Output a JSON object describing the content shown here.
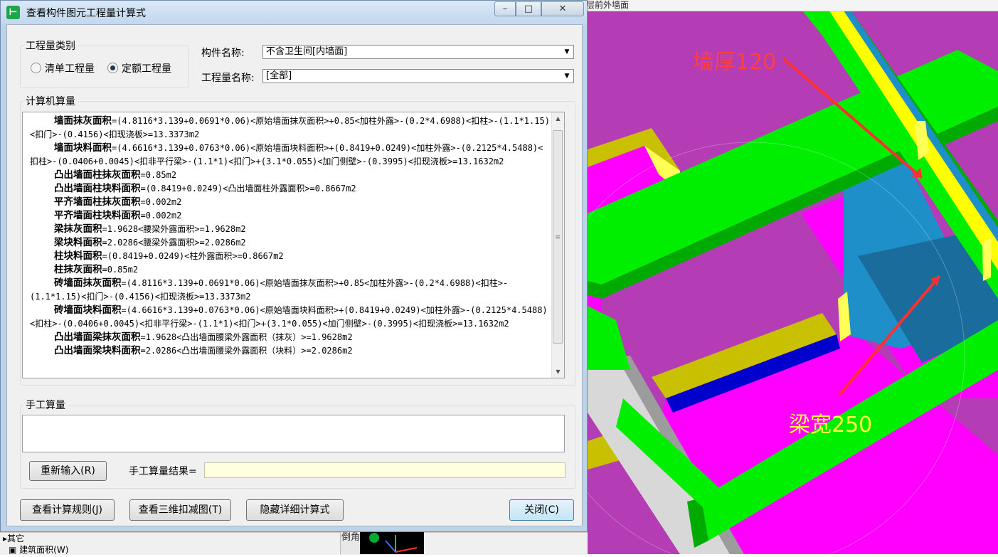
{
  "dialog": {
    "title": "查看构件图元工程量计算式",
    "app_icon": "H-logo-icon",
    "window_buttons": {
      "minimize": "–",
      "maximize": "□",
      "close": "✕"
    }
  },
  "quantity_type": {
    "legend": "工程量类别",
    "options": [
      {
        "label": "清单工程量",
        "selected": false
      },
      {
        "label": "定额工程量",
        "selected": true
      }
    ]
  },
  "component_name": {
    "label": "构件名称:",
    "value": "不含卫生间[内墙面]"
  },
  "quantity_name": {
    "label": "工程量名称:",
    "value": "[全部]"
  },
  "computer_calc": {
    "legend": "计算机算量",
    "lines": [
      {
        "name": "墙面抹灰面积",
        "formula": "=(4.8116*3.139+0.0691*0.06)<原始墙面抹灰面积>+0.85<加柱外露>-(0.2*4.6988)<扣柱>-(1.1*1.15)<扣门>-(0.4156)<扣现浇板>=13.3373m2"
      },
      {
        "name": "墙面块料面积",
        "formula": "=(4.6616*3.139+0.0763*0.06)<原始墙面块料面积>+(0.8419+0.0249)<加柱外露>-(0.2125*4.5488)<扣柱>-(0.0406+0.0045)<扣非平行梁>-(1.1*1)<扣门>+(3.1*0.055)<加门侧壁>-(0.3995)<扣现浇板>=13.1632m2"
      },
      {
        "name": "凸出墙面柱抹灰面积",
        "formula": "=0.85m2"
      },
      {
        "name": "凸出墙面柱块料面积",
        "formula": "=(0.8419+0.0249)<凸出墙面柱外露面积>=0.8667m2"
      },
      {
        "name": "平齐墙面柱抹灰面积",
        "formula": "=0.002m2"
      },
      {
        "name": "平齐墙面柱块料面积",
        "formula": "=0.002m2"
      },
      {
        "name": "梁抹灰面积",
        "formula": "=1.9628<腰梁外露面积>=1.9628m2"
      },
      {
        "name": "梁块料面积",
        "formula": "=2.0286<腰梁外露面积>=2.0286m2"
      },
      {
        "name": "柱块料面积",
        "formula": "=(0.8419+0.0249)<柱外露面积>=0.8667m2"
      },
      {
        "name": "柱抹灰面积",
        "formula": "=0.85m2"
      },
      {
        "name": "砖墙面抹灰面积",
        "formula": "=(4.8116*3.139+0.0691*0.06)<原始墙面抹灰面积>+0.85<加柱外露>-(0.2*4.6988)<扣柱>-(1.1*1.15)<扣门>-(0.4156)<扣现浇板>=13.3373m2"
      },
      {
        "name": "砖墙面块料面积",
        "formula": "=(4.6616*3.139+0.0763*0.06)<原始墙面块料面积>+(0.8419+0.0249)<加柱外露>-(0.2125*4.5488)<扣柱>-(0.0406+0.0045)<扣非平行梁>-(1.1*1)<扣门>+(3.1*0.055)<加门侧壁>-(0.3995)<扣现浇板>=13.1632m2"
      },
      {
        "name": "凸出墙面梁抹灰面积",
        "formula": "=1.9628<凸出墙面腰梁外露面积（抹灰）>=1.9628m2"
      },
      {
        "name": "凸出墙面梁块料面积",
        "formula": "=2.0286<凸出墙面腰梁外露面积（块料）>=2.0286m2"
      }
    ]
  },
  "manual_calc": {
    "legend": "手工算量",
    "reenter_button": "重新输入(R)",
    "result_label": "手工算量结果="
  },
  "footer": {
    "view_rules_button": "查看计算规则(J)",
    "view_3d_button": "查看三维扣减图(T)",
    "hide_detail_button": "隐藏详细计算式",
    "close_button": "关闭(C)"
  },
  "viewport": {
    "toolbar_text": "层前外墙面",
    "annotation_wall": "墙厚120",
    "annotation_beam": "梁宽250",
    "colors": {
      "wall": "#b43cb4",
      "magenta": "#ff00ff",
      "beam_green": "#00ee00",
      "yellow": "#ffff00",
      "olive": "#c8c000",
      "blue": "#0000cc",
      "teal": "#1a8c9c"
    }
  },
  "background_app": {
    "tree_item_other": "其它",
    "tree_item_area": "建筑面积(W)",
    "side_label": "倒角"
  }
}
